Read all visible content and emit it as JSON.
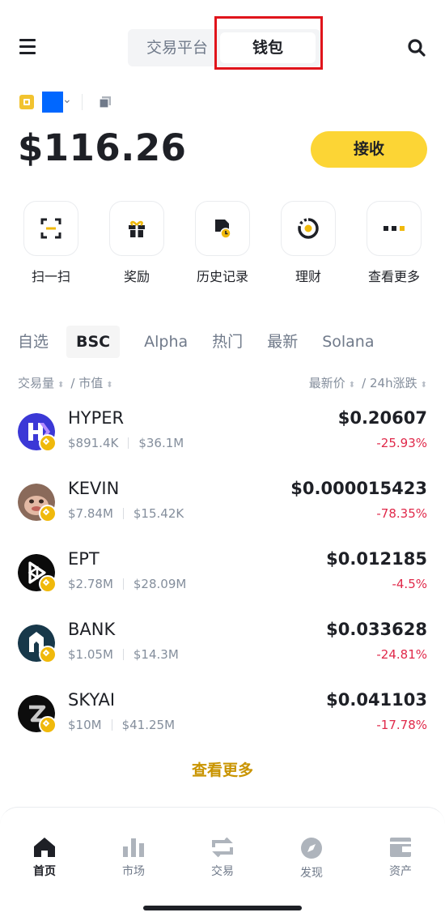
{
  "header": {
    "tab_exchange": "交易平台",
    "tab_wallet": "钱包",
    "menu_icon": "hamburger-menu-icon",
    "search_icon": "search-icon"
  },
  "account": {
    "balance": "$116.26",
    "receive_label": "接收",
    "copy_icon": "copy-icon"
  },
  "quick_actions": [
    {
      "label": "扫一扫",
      "icon": "scan-icon"
    },
    {
      "label": "奖励",
      "icon": "gift-icon"
    },
    {
      "label": "历史记录",
      "icon": "history-icon"
    },
    {
      "label": "理财",
      "icon": "earn-icon"
    },
    {
      "label": "查看更多",
      "icon": "more-icon"
    }
  ],
  "market_tabs": [
    "自选",
    "BSC",
    "Alpha",
    "热门",
    "最新",
    "Solana"
  ],
  "active_tab": "BSC",
  "columns": {
    "volume": "交易量",
    "mcap": "市值",
    "last_price": "最新价",
    "change_24h": "24h涨跌"
  },
  "tokens": [
    {
      "symbol": "HYPER",
      "volume": "$891.4K",
      "mcap": "$36.1M",
      "price": "$0.20607",
      "change": "-25.93%"
    },
    {
      "symbol": "KEVIN",
      "volume": "$7.84M",
      "mcap": "$15.42K",
      "price": "$0.000015423",
      "change": "-78.35%"
    },
    {
      "symbol": "EPT",
      "volume": "$2.78M",
      "mcap": "$28.09M",
      "price": "$0.012185",
      "change": "-4.5%"
    },
    {
      "symbol": "BANK",
      "volume": "$1.05M",
      "mcap": "$14.3M",
      "price": "$0.033628",
      "change": "-24.81%"
    },
    {
      "symbol": "SKYAI",
      "volume": "$10M",
      "mcap": "$41.25M",
      "price": "$0.041103",
      "change": "-17.78%"
    }
  ],
  "view_more": "查看更多",
  "bottom_nav": [
    {
      "label": "首页",
      "icon": "home-icon"
    },
    {
      "label": "市场",
      "icon": "chart-icon"
    },
    {
      "label": "交易",
      "icon": "swap-icon"
    },
    {
      "label": "发现",
      "icon": "compass-icon"
    },
    {
      "label": "资产",
      "icon": "wallet-icon"
    }
  ],
  "colors": {
    "brand_yellow": "#fcd535",
    "negative": "#e0294a",
    "link_gold": "#c99400",
    "highlight": "#e0141b"
  }
}
